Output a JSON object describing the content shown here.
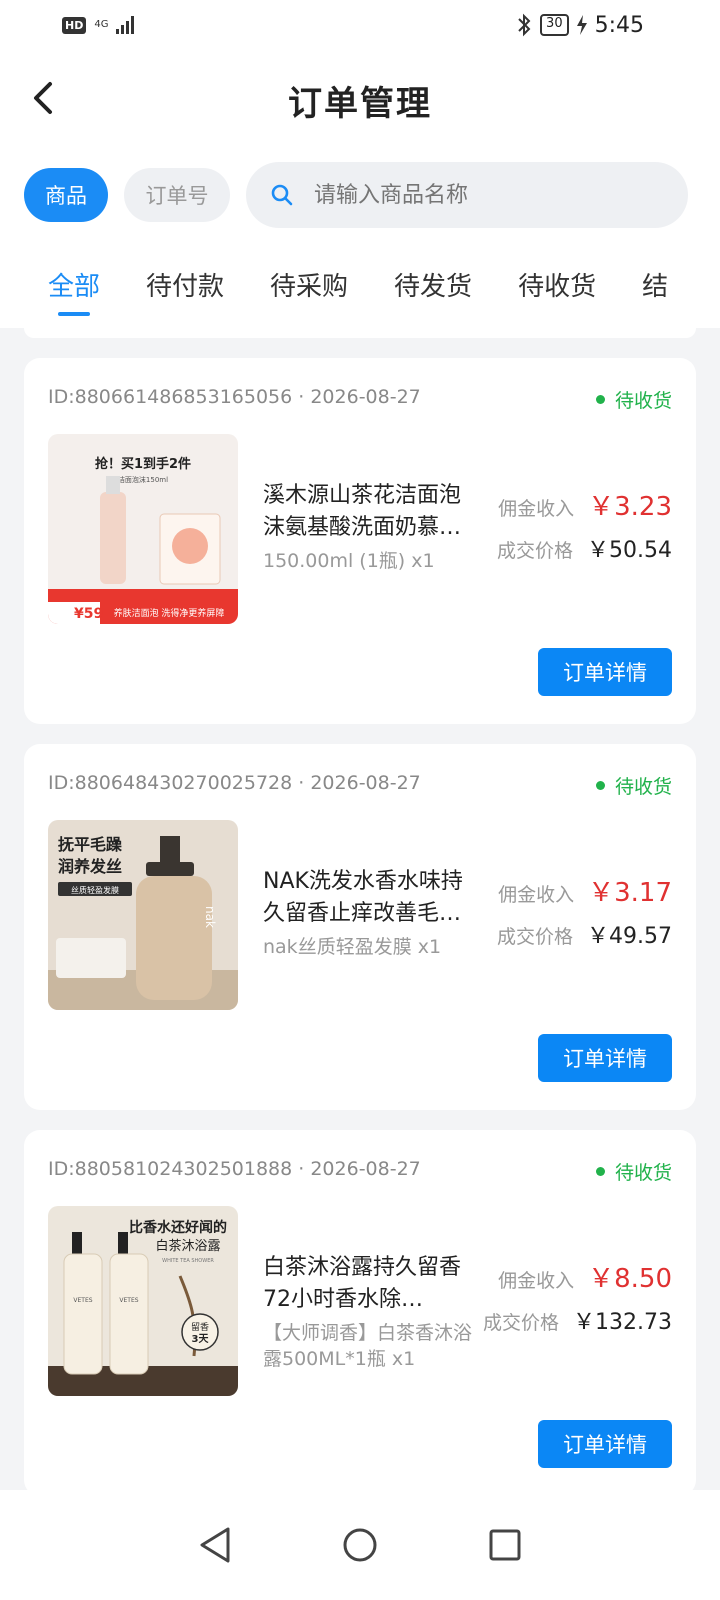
{
  "status_bar": {
    "hd": "HD",
    "network": "4G",
    "battery": "30",
    "time": "5:45"
  },
  "header": {
    "title": "订单管理"
  },
  "search": {
    "filter_buttons": [
      {
        "label": "商品",
        "active": true
      },
      {
        "label": "订单号",
        "active": false
      }
    ],
    "placeholder": "请输入商品名称"
  },
  "tabs": [
    {
      "label": "全部",
      "active": true
    },
    {
      "label": "待付款"
    },
    {
      "label": "待采购"
    },
    {
      "label": "待发货"
    },
    {
      "label": "待收货"
    },
    {
      "label": "结"
    }
  ],
  "colors": {
    "accent": "#1b8cf5",
    "price_red": "#e03131",
    "status_green": "#21b24b"
  },
  "orders": [
    {
      "id_date": "ID:880661486853165056 · 2026-08-27",
      "status": "待收货",
      "image": {
        "promo_top": "抢！买1到手2件",
        "promo_sub": "洁面泡沫150ml",
        "price_tag": "¥59",
        "banner": "养肤洁面泡 洗得净更养屏障"
      },
      "name": "溪木源山茶花洁面泡沫氨基酸洗面奶慕…",
      "spec": "150.00ml (1瓶) x1",
      "commission_label": "佣金收入",
      "commission": "￥3.23",
      "deal_label": "成交价格",
      "deal_price": "￥50.54",
      "button": "订单详情"
    },
    {
      "id_date": "ID:880648430270025728 · 2026-08-27",
      "status": "待收货",
      "image": {
        "line1": "抚平毛躁",
        "line2": "润养发丝",
        "tag": "丝质轻盈发膜",
        "brand": "nak"
      },
      "name": "NAK洗发水香水味持久留香止痒改善毛…",
      "spec": "nak丝质轻盈发膜 x1",
      "commission_label": "佣金收入",
      "commission": "￥3.17",
      "deal_label": "成交价格",
      "deal_price": "￥49.57",
      "button": "订单详情"
    },
    {
      "id_date": "ID:880581024302501888 · 2026-08-27",
      "status": "待收货",
      "image": {
        "line1": "比香水还好闻的",
        "line2": "白茶沐浴露",
        "sub": "WHITE TEA SHOWER",
        "brand": "VETES",
        "badge_top": "留香",
        "badge_bottom": "3天"
      },
      "name": "白茶沐浴露持久留香72小时香水除…",
      "spec": "【大师调香】白茶香沐浴露500ML*1瓶 x1",
      "commission_label": "佣金收入",
      "commission": "￥8.50",
      "deal_label": "成交价格",
      "deal_price": "￥132.73",
      "button": "订单详情"
    }
  ],
  "nav_bar": {
    "icons": [
      "back-triangle-icon",
      "home-circle-icon",
      "recents-square-icon"
    ]
  }
}
